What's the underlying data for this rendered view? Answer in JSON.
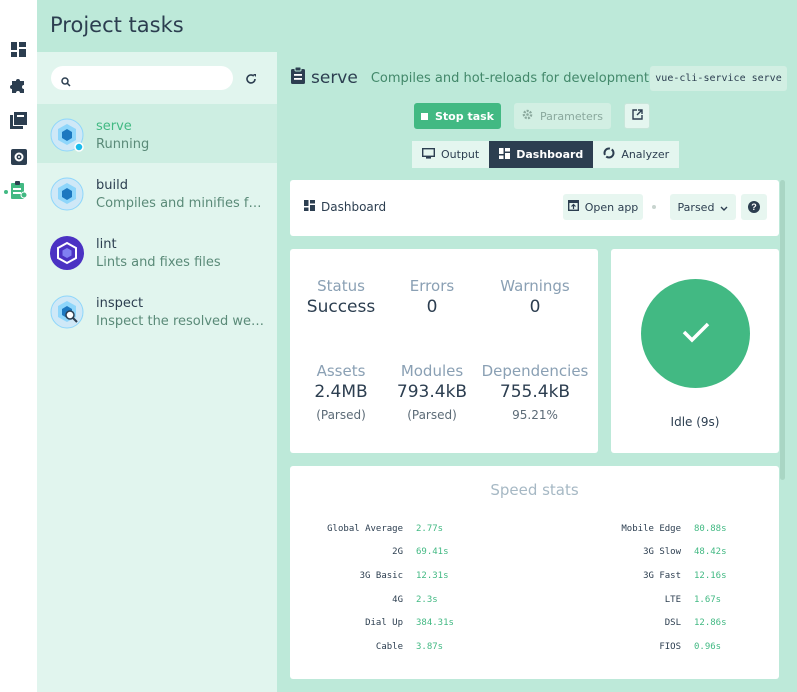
{
  "header": {
    "title": "Project tasks"
  },
  "search": {
    "placeholder": ""
  },
  "tasks": [
    {
      "name": "serve",
      "desc": "Running",
      "active": true
    },
    {
      "name": "build",
      "desc": "Compiles and minifies for production"
    },
    {
      "name": "lint",
      "desc": "Lints and fixes files"
    },
    {
      "name": "inspect",
      "desc": "Inspect the resolved webpack config"
    }
  ],
  "task_detail": {
    "name": "serve",
    "desc": "Compiles and hot-reloads for development",
    "command": "vue-cli-service serve",
    "stop_label": "Stop task",
    "params_label": "Parameters"
  },
  "tabs": {
    "output": "Output",
    "dashboard": "Dashboard",
    "analyzer": "Analyzer"
  },
  "dashboard": {
    "title": "Dashboard",
    "open_app": "Open app",
    "mode": "Parsed"
  },
  "stats": {
    "status": {
      "label": "Status",
      "value": "Success"
    },
    "errors": {
      "label": "Errors",
      "value": "0"
    },
    "warnings": {
      "label": "Warnings",
      "value": "0"
    },
    "assets": {
      "label": "Assets",
      "value": "2.4MB",
      "sub": "(Parsed)"
    },
    "modules": {
      "label": "Modules",
      "value": "793.4kB",
      "sub": "(Parsed)"
    },
    "dependencies": {
      "label": "Dependencies",
      "value": "755.4kB",
      "sub": "95.21%"
    }
  },
  "status_card": {
    "label": "Idle (9s)"
  },
  "speed": {
    "title": "Speed stats",
    "left": [
      {
        "label": "Global Average",
        "value": "2.77s"
      },
      {
        "label": "2G",
        "value": "69.41s"
      },
      {
        "label": "3G Basic",
        "value": "12.31s"
      },
      {
        "label": "4G",
        "value": "2.3s"
      },
      {
        "label": "Dial Up",
        "value": "384.31s"
      },
      {
        "label": "Cable",
        "value": "3.87s"
      }
    ],
    "right": [
      {
        "label": "Mobile Edge",
        "value": "80.88s"
      },
      {
        "label": "3G Slow",
        "value": "48.42s"
      },
      {
        "label": "3G Fast",
        "value": "12.16s"
      },
      {
        "label": "LTE",
        "value": "1.67s"
      },
      {
        "label": "DSL",
        "value": "12.86s"
      },
      {
        "label": "FIOS",
        "value": "0.96s"
      }
    ]
  },
  "colors": {
    "accent": "#42b983",
    "dark": "#2c3e50",
    "header_bg": "#bde9d9",
    "list_bg": "#e1f5ee"
  }
}
